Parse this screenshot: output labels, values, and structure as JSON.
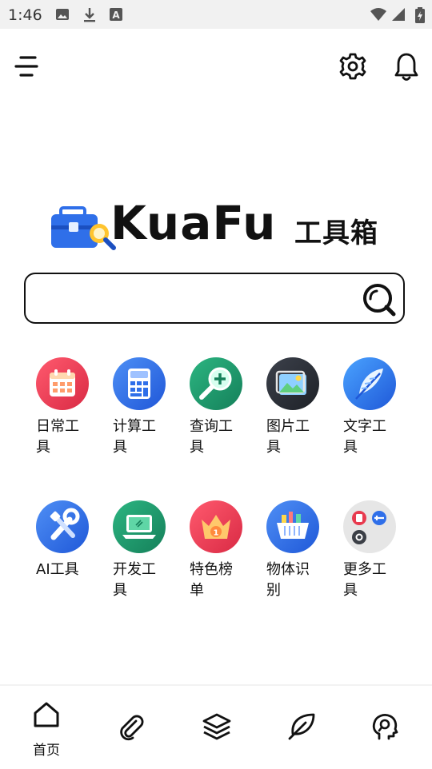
{
  "status_bar": {
    "time": "1:46",
    "icons": [
      "image-icon",
      "download-icon",
      "a-badge-icon",
      "wifi-icon",
      "signal-icon",
      "battery-icon"
    ]
  },
  "header": {
    "icons": [
      "menu-icon",
      "gear-icon",
      "bell-icon"
    ]
  },
  "logo": {
    "brand": "KuaFu",
    "cn": "工具箱"
  },
  "search": {
    "value": "",
    "placeholder": ""
  },
  "tools": [
    {
      "label": "日常工具",
      "icon": "calendar-icon",
      "color": "#e83a4e"
    },
    {
      "label": "计算工具",
      "icon": "calculator-icon",
      "color": "#2f6fe9"
    },
    {
      "label": "查询工具",
      "icon": "magnifier-plus-icon",
      "color": "#1e9a6e"
    },
    {
      "label": "图片工具",
      "icon": "picture-icon",
      "color": "#2b2f36"
    },
    {
      "label": "文字工具",
      "icon": "feather-icon",
      "color": "#2a7ae8"
    },
    {
      "label": "AI工具",
      "icon": "tools-icon",
      "color": "#2c6ee6"
    },
    {
      "label": "开发工具",
      "icon": "laptop-icon",
      "color": "#1e9a6e"
    },
    {
      "label": "特色榜单",
      "icon": "crown-icon",
      "color": "#e83a4e"
    },
    {
      "label": "物体识别",
      "icon": "basket-icon",
      "color": "#2f6fe9"
    },
    {
      "label": "更多工具",
      "icon": "more-apps-icon",
      "color": "#e6e6e6"
    }
  ],
  "bottom_nav": {
    "home_label": "首页",
    "items": [
      "home-icon",
      "paperclip-icon",
      "layers-icon",
      "leaf-icon",
      "brain-icon"
    ]
  }
}
